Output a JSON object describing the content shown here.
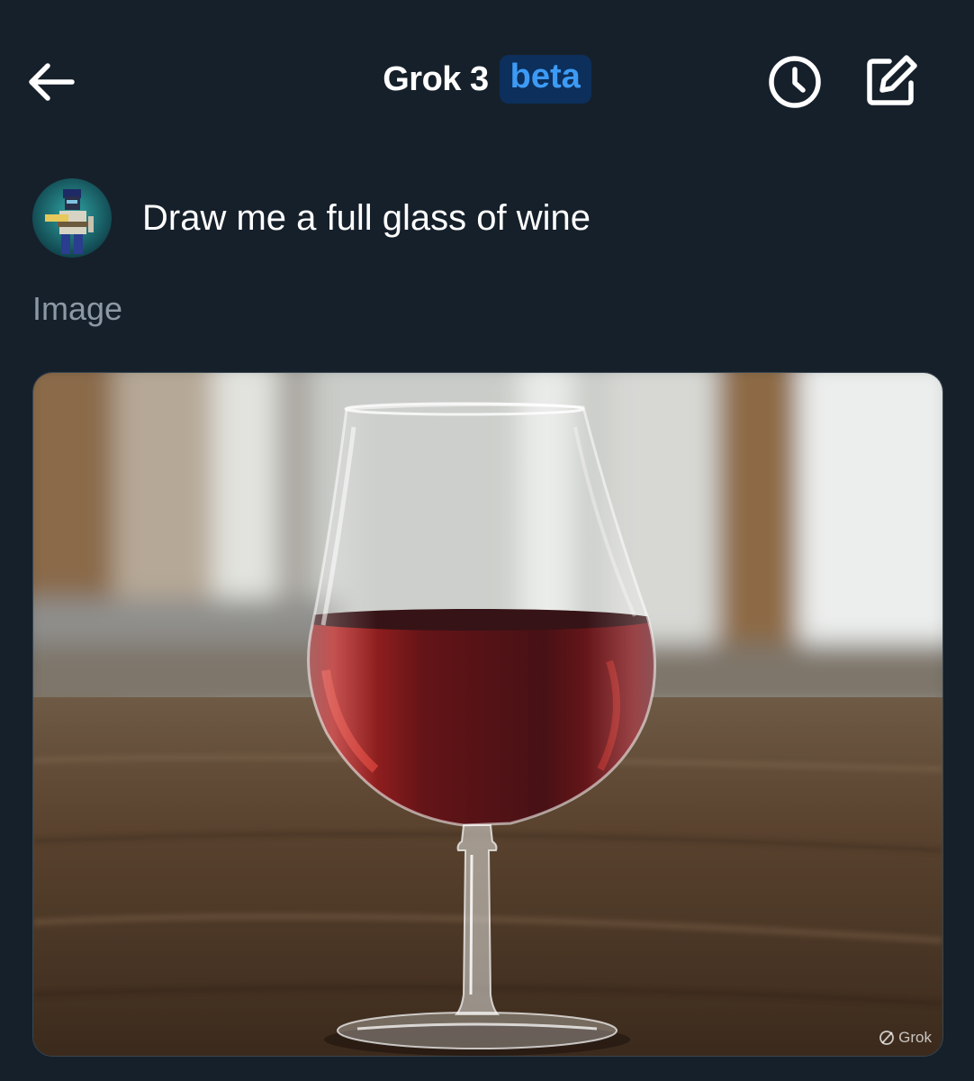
{
  "header": {
    "title": "Grok 3",
    "badge": "beta"
  },
  "prompt": {
    "text": "Draw me a full glass of wine"
  },
  "section": {
    "label": "Image"
  },
  "image_card": {
    "watermark": "Grok"
  },
  "icons": {
    "back": "arrow-left-icon",
    "history": "clock-icon",
    "compose": "compose-icon",
    "watermark": "grok-logo-icon"
  },
  "colors": {
    "background": "#16202b",
    "badge_bg": "#0c2f5b",
    "badge_text": "#3d9bf5",
    "secondary_text": "#8b98a5",
    "wine": "#6e0a0f"
  }
}
